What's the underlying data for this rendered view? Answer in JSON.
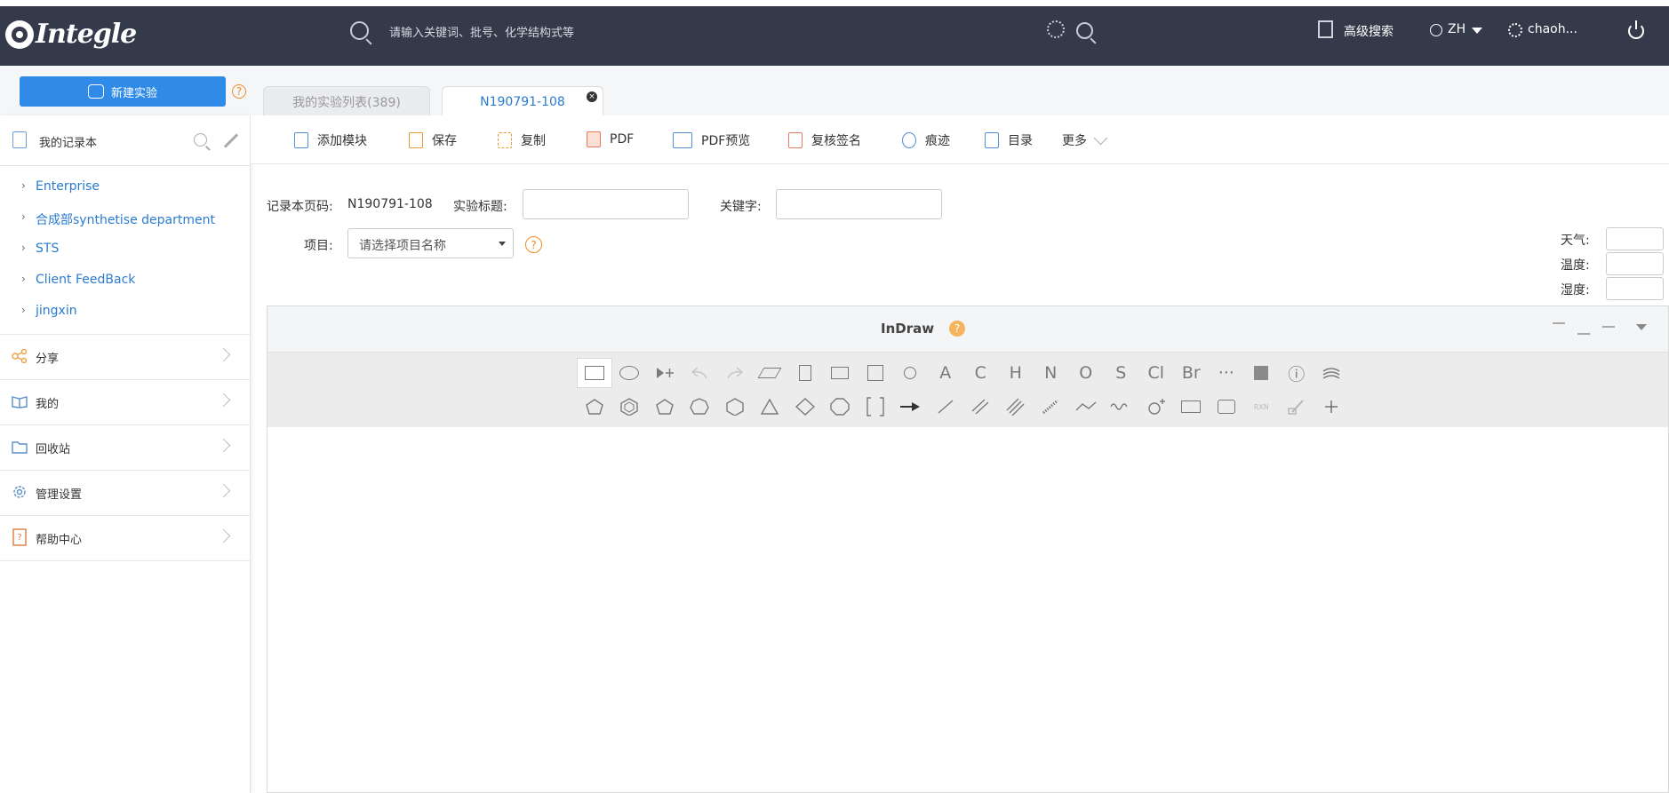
{
  "header": {
    "logo_text": "Integle",
    "search_placeholder": "请输入关键词、批号、化学结构式等",
    "advanced_search": "高级搜索",
    "language": "ZH",
    "user": "chaoh..."
  },
  "actions": {
    "new_experiment": "新建实验",
    "help": "?"
  },
  "tabs": [
    {
      "label": "我的实验列表(389)"
    },
    {
      "label": "N190791-108",
      "close": "×"
    }
  ],
  "sidebar": {
    "notebook_label": "我的记录本",
    "tree": [
      {
        "chevron": "›",
        "label": "Enterprise"
      },
      {
        "chevron": "›",
        "label": "合成部synthetise department"
      },
      {
        "chevron": "›",
        "label": "STS"
      },
      {
        "chevron": "›",
        "label": "Client FeedBack"
      },
      {
        "chevron": "›",
        "label": "jingxin"
      }
    ],
    "nav": [
      {
        "label": "分享",
        "icon": "share-icon"
      },
      {
        "label": "我的",
        "icon": "book-icon"
      },
      {
        "label": "回收站",
        "icon": "folder-icon"
      },
      {
        "label": "管理设置",
        "icon": "gear-icon"
      },
      {
        "label": "帮助中心",
        "icon": "help-doc-icon"
      }
    ]
  },
  "toolbar": {
    "add_module": "添加模块",
    "save": "保存",
    "copy": "复制",
    "pdf": "PDF",
    "pdf_preview": "PDF预览",
    "review_sign": "复核签名",
    "trace": "痕迹",
    "toc": "目录",
    "more": "更多"
  },
  "form": {
    "page_code_label": "记录本页码:",
    "page_code_value": "N190791-108",
    "title_label": "实验标题:",
    "title_value": "",
    "keyword_label": "关键字:",
    "keyword_value": "",
    "project_label": "项目:",
    "project_placeholder": "请选择项目名称",
    "weather_label": "天气:",
    "temperature_label": "温度:",
    "humidity_label": "湿度:"
  },
  "indraw": {
    "title": "InDraw",
    "help": "?",
    "row1_text_tools": [
      "A",
      "C",
      "H",
      "N",
      "O",
      "S",
      "Cl",
      "Br",
      "···",
      "ⓘ"
    ],
    "row2_text_tools": [
      "RXN"
    ]
  },
  "colors": {
    "topbar_bg": "#353a4b",
    "primary": "#2f8be7",
    "link": "#2a7bd0",
    "help_orange": "#f08a24"
  }
}
